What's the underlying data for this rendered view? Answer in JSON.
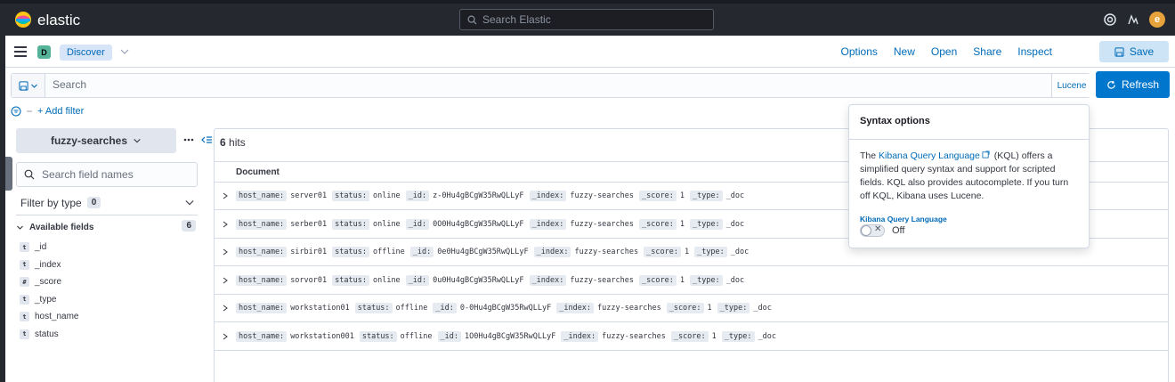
{
  "header": {
    "brand": "elastic",
    "search_placeholder": "Search Elastic",
    "avatar_initial": "e"
  },
  "nav": {
    "space_badge": "D",
    "breadcrumb": "Discover",
    "links": [
      "Options",
      "New",
      "Open",
      "Share",
      "Inspect"
    ],
    "save_label": "Save"
  },
  "query": {
    "placeholder": "Search",
    "language": "Lucene",
    "refresh_label": "Refresh"
  },
  "filters": {
    "add_label": "+ Add filter"
  },
  "sidebar": {
    "index_pattern": "fuzzy-searches",
    "field_search_placeholder": "Search field names",
    "filter_by_type": "Filter by type",
    "filter_count": "0",
    "available_label": "Available fields",
    "available_count": "6",
    "fields": [
      {
        "type": "t",
        "name": "_id"
      },
      {
        "type": "t",
        "name": "_index"
      },
      {
        "type": "#",
        "name": "_score"
      },
      {
        "type": "t",
        "name": "_type"
      },
      {
        "type": "t",
        "name": "host_name"
      },
      {
        "type": "t",
        "name": "status"
      }
    ]
  },
  "results": {
    "hits_count": "6",
    "hits_label": "hits",
    "column_header": "Document",
    "rows": [
      [
        [
          "host_name:",
          "server01"
        ],
        [
          "status:",
          "online"
        ],
        [
          "_id:",
          "z-0Hu4gBCgW35RwQLLyF"
        ],
        [
          "_index:",
          "fuzzy-searches"
        ],
        [
          "_score:",
          "1"
        ],
        [
          "_type:",
          "_doc"
        ]
      ],
      [
        [
          "host_name:",
          "serber01"
        ],
        [
          "status:",
          "online"
        ],
        [
          "_id:",
          "0O0Hu4gBCgW35RwQLLyF"
        ],
        [
          "_index:",
          "fuzzy-searches"
        ],
        [
          "_score:",
          "1"
        ],
        [
          "_type:",
          "_doc"
        ]
      ],
      [
        [
          "host_name:",
          "sirbir01"
        ],
        [
          "status:",
          "offline"
        ],
        [
          "_id:",
          "0e0Hu4gBCgW35RwQLLyF"
        ],
        [
          "_index:",
          "fuzzy-searches"
        ],
        [
          "_score:",
          "1"
        ],
        [
          "_type:",
          "_doc"
        ]
      ],
      [
        [
          "host_name:",
          "sorvor01"
        ],
        [
          "status:",
          "online"
        ],
        [
          "_id:",
          "0u0Hu4gBCgW35RwQLLyF"
        ],
        [
          "_index:",
          "fuzzy-searches"
        ],
        [
          "_score:",
          "1"
        ],
        [
          "_type:",
          "_doc"
        ]
      ],
      [
        [
          "host_name:",
          "workstation01"
        ],
        [
          "status:",
          "offline"
        ],
        [
          "_id:",
          "0-0Hu4gBCgW35RwQLLyF"
        ],
        [
          "_index:",
          "fuzzy-searches"
        ],
        [
          "_score:",
          "1"
        ],
        [
          "_type:",
          "_doc"
        ]
      ],
      [
        [
          "host_name:",
          "workstation001"
        ],
        [
          "status:",
          "offline"
        ],
        [
          "_id:",
          "1O0Hu4gBCgW35RwQLLyF"
        ],
        [
          "_index:",
          "fuzzy-searches"
        ],
        [
          "_score:",
          "1"
        ],
        [
          "_type:",
          "_doc"
        ]
      ]
    ]
  },
  "popover": {
    "title": "Syntax options",
    "body_pre": "The ",
    "body_link": "Kibana Query Language",
    "body_post": " (KQL) offers a simplified query syntax and support for scripted fields. KQL also provides autocomplete. If you turn off KQL, Kibana uses Lucene.",
    "toggle_label": "Kibana Query Language",
    "toggle_state": "Off"
  },
  "colors": {
    "accent": "#0077cc",
    "link": "#006bb8",
    "header_bg": "#25282f",
    "space_badge": "#54b399",
    "avatar": "#e7a33b"
  }
}
